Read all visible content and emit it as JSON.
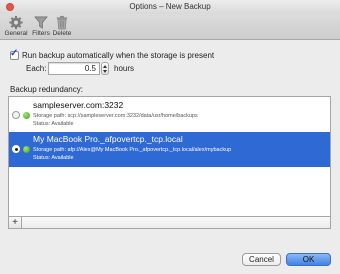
{
  "window": {
    "title": "Options – New Backup"
  },
  "toolbar": {
    "items": [
      {
        "label": "General",
        "icon": "gear-icon"
      },
      {
        "label": "Filters",
        "icon": "funnel-icon"
      },
      {
        "label": "Delete",
        "icon": "trash-icon"
      }
    ]
  },
  "options": {
    "auto_backup_checked": true,
    "auto_backup_label": "Run backup automatically when the storage is present",
    "each_label": "Each:",
    "hours_value": "0.5",
    "hours_unit": "hours",
    "redundancy_label": "Backup redundancy:"
  },
  "storages": [
    {
      "name": "sampleserver.com:3232",
      "path": "Storage path: scp://sampleserver.com:3232/data/usr/home/backups",
      "status": "Status: Available",
      "selected": false
    },
    {
      "name": "My MacBook Pro._afpovertcp._tcp.local",
      "path": "Storage path: afp://Alex@My MacBook Pro._afpovertcp._tcp.local/alex/mybackup",
      "status": "Status: Available",
      "selected": true
    }
  ],
  "list_add_label": "+",
  "buttons": {
    "cancel": "Cancel",
    "ok": "OK"
  },
  "colors": {
    "selection": "#2f69d4",
    "status_available": "#3e9b1c",
    "default_button": "#3d83e6"
  }
}
